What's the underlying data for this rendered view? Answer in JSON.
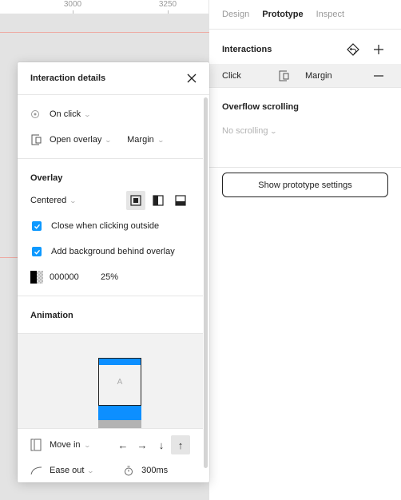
{
  "canvas": {
    "ruler_labels": [
      "3000",
      "3250"
    ],
    "guide_color": "#eea9a2"
  },
  "panel": {
    "tabs": [
      {
        "label": "Design",
        "active": false
      },
      {
        "label": "Prototype",
        "active": true
      },
      {
        "label": "Inspect",
        "active": false
      }
    ],
    "interactions": {
      "title": "Interactions",
      "add_icon": "plus-icon",
      "flow_icon": "flow-starting-point-icon",
      "items": [
        {
          "trigger": "Click",
          "action_icon": "open-overlay-icon",
          "destination": "Margin",
          "remove_icon": "minus-icon"
        }
      ]
    },
    "overflow": {
      "title": "Overflow scrolling",
      "value": "No scrolling"
    },
    "settings_button": "Show prototype settings"
  },
  "popup": {
    "title": "Interaction details",
    "close_icon": "close-icon",
    "trigger": {
      "icon": "target-icon",
      "value": "On click"
    },
    "action": {
      "icon": "open-overlay-icon",
      "value": "Open overlay",
      "destination": "Margin"
    },
    "overlay": {
      "title": "Overlay",
      "position": "Centered",
      "position_buttons": [
        {
          "icon": "overlay-centered-icon",
          "active": true
        },
        {
          "icon": "overlay-left-icon",
          "active": false
        },
        {
          "icon": "overlay-bottom-icon",
          "active": false
        }
      ],
      "close_outside": {
        "label": "Close when clicking outside",
        "checked": true
      },
      "add_background": {
        "label": "Add background behind overlay",
        "checked": true
      },
      "background_color": "000000",
      "background_opacity": "25%"
    },
    "animation": {
      "title": "Animation",
      "preview_frame_label": "A",
      "accent_color": "#0d8fff",
      "type_icon": "move-in-icon",
      "type": "Move in",
      "directions": [
        {
          "glyph": "←",
          "name": "left",
          "active": false
        },
        {
          "glyph": "→",
          "name": "right",
          "active": false
        },
        {
          "glyph": "↓",
          "name": "down",
          "active": false
        },
        {
          "glyph": "↑",
          "name": "up",
          "active": true
        }
      ],
      "easing_icon": "ease-curve-icon",
      "easing": "Ease out",
      "duration_icon": "timer-icon",
      "duration": "300ms"
    }
  }
}
